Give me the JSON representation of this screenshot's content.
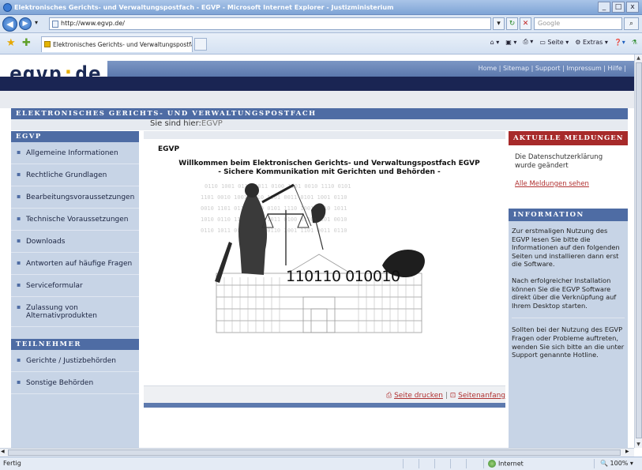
{
  "window": {
    "title": "Elektronisches Gerichts- und Verwaltungspostfach - EGVP - Microsoft Internet Explorer - Justizministerium",
    "controls": [
      "_",
      "□",
      "x"
    ]
  },
  "browser": {
    "url": "http://www.egvp.de/",
    "search_placeholder": "Google",
    "tab_label": "Elektronisches Gerichts- und Verwaltungspostfach - E...",
    "commands": [
      "Seite",
      "Extras"
    ],
    "status_text": "Fertig",
    "zone": "Internet",
    "zoom": "100%"
  },
  "site": {
    "logo_left": "egvp",
    "logo_dot": ":",
    "logo_right": "de",
    "top_links": [
      "Home",
      "Sitemap",
      "Support",
      "Impressum",
      "Hilfe"
    ],
    "section_title": "ELEKTRONISCHES GERICHTS- UND VERWALTUNGSPOSTFACH",
    "breadcrumb_label": "Sie sind hier:",
    "breadcrumb_current": "EGVP"
  },
  "sidebar": {
    "egvp_heading": "EGVP",
    "egvp_items": [
      "Allgemeine Informationen",
      "Rechtliche Grundlagen",
      "Bearbeitungsvoraussetzungen",
      "Technische Voraussetzungen",
      "Downloads",
      "Antworten auf häufige Fragen",
      "Serviceformular",
      "Zulassung von Alternativprodukten"
    ],
    "teilnehmer_heading": "TEILNEHMER",
    "teilnehmer_items": [
      "Gerichte / Justizbehörden",
      "Sonstige Behörden"
    ]
  },
  "main": {
    "heading": "EGVP",
    "welcome_line1": "Willkommen beim Elektronischen Gerichts- und Verwaltungspostfach EGVP",
    "welcome_line2": "- Sichere Kommunikation mit Gerichten und Behörden -",
    "binary_text": "110110 010010",
    "print_link": "Seite drucken",
    "top_link": "Seitenanfang"
  },
  "right": {
    "news_heading": "AKTUELLE MELDUNGEN",
    "news_text": "Die Datenschutzerklärung wurde geändert",
    "news_link": "Alle Meldungen sehen",
    "info_heading": "INFORMATION",
    "info_p1": "Zur erstmaligen Nutzung des EGVP lesen Sie bitte die Informationen auf den folgenden Seiten und installieren dann erst die Software.",
    "info_p2": "Nach erfolgreicher Installation können Sie die EGVP Software direkt über die Verknüpfung auf Ihrem Desktop starten.",
    "info_p3": "Sollten bei der Nutzung des EGVP Fragen oder Probleme auftreten, wenden Sie sich bitte an die unter Support genannte Hotline."
  }
}
